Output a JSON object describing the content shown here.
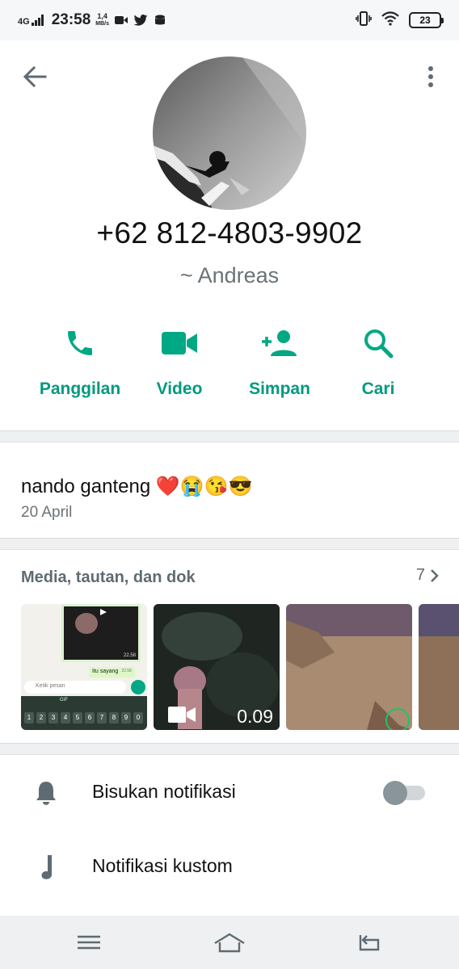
{
  "status_bar": {
    "network": "4G",
    "time": "23:58",
    "speed_value": "1,4",
    "speed_unit": "MB/s",
    "battery": "23",
    "icons": [
      "video-icon",
      "twitter-icon",
      "data-saver-icon",
      "vibrate-icon",
      "wifi-icon",
      "battery-icon"
    ]
  },
  "contact": {
    "phone": "+62 812-4803-9902",
    "alias": "~ Andreas"
  },
  "actions": [
    {
      "label": "Panggilan",
      "icon": "phone-icon"
    },
    {
      "label": "Video",
      "icon": "video-camera-icon"
    },
    {
      "label": "Simpan",
      "icon": "add-person-icon"
    },
    {
      "label": "Cari",
      "icon": "search-icon"
    }
  ],
  "about": {
    "text": "nando ganteng ❤️😭😘😎",
    "date": "20 April"
  },
  "media": {
    "title": "Media, tautan, dan dok",
    "count": "7",
    "thumb1": {
      "time_a": "22.58",
      "bubble": "Itu sayang",
      "time_b": "22.58",
      "placeholder": "Ketik pesan",
      "gif": "GIF",
      "keys": [
        "1",
        "2",
        "3",
        "4",
        "5",
        "6",
        "7",
        "8",
        "9",
        "0"
      ]
    },
    "thumb2_duration": "0.09"
  },
  "settings": [
    {
      "label": "Bisukan notifikasi",
      "icon": "bell-icon",
      "toggle_on": false
    },
    {
      "label": "Notifikasi kustom",
      "icon": "music-note-icon"
    }
  ],
  "colors": {
    "accent": "#00a884",
    "accent_text": "#00997f",
    "secondary_text": "#6b7378",
    "icon_gray": "#5f6b72"
  }
}
